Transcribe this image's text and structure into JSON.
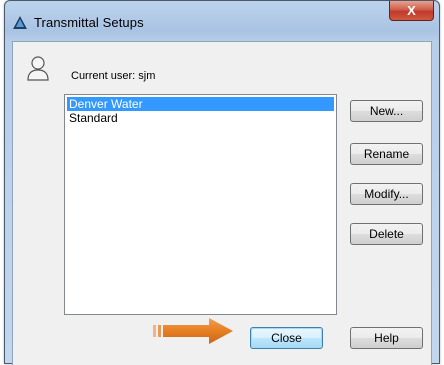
{
  "window": {
    "title": "Transmittal Setups",
    "close_glyph": "X"
  },
  "user": {
    "label": "Current user: sjm",
    "icon": "user-icon"
  },
  "setups": {
    "items": [
      "Denver Water",
      "Standard"
    ],
    "selected_index": 0
  },
  "buttons": {
    "new": "New...",
    "rename": "Rename",
    "modify": "Modify...",
    "delete": "Delete",
    "close": "Close",
    "help": "Help"
  },
  "annotation": {
    "arrow_color": "#e67e22",
    "points_to": "close-button"
  },
  "colors": {
    "selection": "#3399ff",
    "close_accent": "#c0392b"
  }
}
